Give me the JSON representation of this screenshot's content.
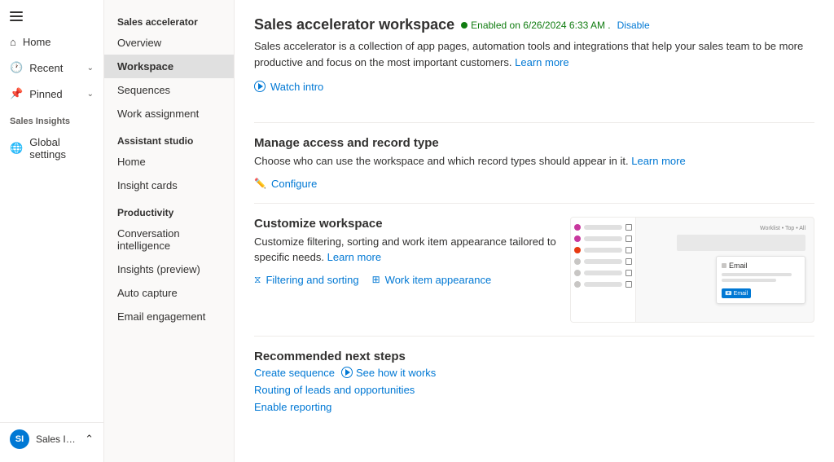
{
  "leftNav": {
    "items": [
      {
        "label": "Home",
        "icon": "home"
      },
      {
        "label": "Recent",
        "icon": "recent",
        "hasChevron": true
      },
      {
        "label": "Pinned",
        "icon": "pinned",
        "hasChevron": true
      }
    ],
    "sections": [
      {
        "label": "Sales Insights",
        "items": [
          {
            "label": "Global settings",
            "icon": "global"
          }
        ]
      }
    ],
    "bottom": {
      "initials": "SI",
      "label": "Sales Insights sett...",
      "hasChevron": true
    }
  },
  "midNav": {
    "sections": [
      {
        "label": "Sales accelerator",
        "items": [
          {
            "label": "Overview",
            "active": false
          },
          {
            "label": "Workspace",
            "active": true
          },
          {
            "label": "Sequences",
            "active": false
          },
          {
            "label": "Work assignment",
            "active": false
          }
        ]
      },
      {
        "label": "Assistant studio",
        "items": [
          {
            "label": "Home",
            "active": false
          },
          {
            "label": "Insight cards",
            "active": false
          }
        ]
      },
      {
        "label": "Productivity",
        "items": [
          {
            "label": "Conversation intelligence",
            "active": false
          },
          {
            "label": "Insights (preview)",
            "active": false
          },
          {
            "label": "Auto capture",
            "active": false
          },
          {
            "label": "Email engagement",
            "active": false
          }
        ]
      }
    ]
  },
  "main": {
    "title": "Sales accelerator workspace",
    "statusText": "Enabled on 6/26/2024 6:33 AM .",
    "disableLabel": "Disable",
    "description": "Sales accelerator is a collection of app pages, automation tools and integrations that help your sales team to be more productive and focus on the most important customers.",
    "learnMoreLabel": "Learn more",
    "watchIntroLabel": "Watch intro",
    "sections": {
      "manageAccess": {
        "title": "Manage access and record type",
        "description": "Choose who can use the workspace and which record types should appear in it.",
        "learnMoreLabel": "Learn more",
        "configureLabel": "Configure"
      },
      "customizeWorkspace": {
        "title": "Customize workspace",
        "description": "Customize filtering, sorting and work item appearance tailored to specific needs.",
        "learnMoreLabel": "Learn more",
        "actions": [
          {
            "label": "Filtering and sorting",
            "icon": "filter"
          },
          {
            "label": "Work item appearance",
            "icon": "grid"
          }
        ]
      },
      "recommendedNextSteps": {
        "title": "Recommended next steps",
        "links": [
          {
            "label": "Create sequence",
            "hasSeeHow": true,
            "seeHowLabel": "See how it works"
          },
          {
            "label": "Routing of leads and opportunities"
          },
          {
            "label": "Enable reporting"
          }
        ]
      }
    }
  }
}
